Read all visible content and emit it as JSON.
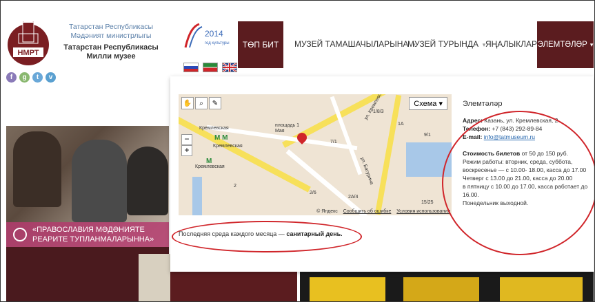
{
  "header": {
    "org_line1": "Татарстан Республикасы",
    "org_line2": "Мәдәният министрлыгы",
    "org_line3": "Татарстан Республикасы",
    "org_line4": "Милли музее",
    "logo_text": "НМРТ",
    "year_logo": "2014",
    "year_sub": "год культуры",
    "social": [
      "f",
      "g",
      "t",
      "v"
    ]
  },
  "nav": {
    "items": [
      "ТӨП БИТ",
      "МУЗЕЙ ТАМАШАЧЫЛАРЫНА",
      "МУЗЕЙ ТУРЫНДА",
      "ЯҢАЛЫКЛАР",
      "ЭЛЕМТӘЛӘР"
    ],
    "active_index": 0
  },
  "banner": {
    "text": "«ПРАВОСЛАВИЯ МӘДӘНИЯТЕ РЕАРИТЕ ТУПЛАНМАЛАРЫННА»"
  },
  "map": {
    "schema_label": "Схема",
    "labels": [
      "Кремлевская",
      "Кремлевская",
      "Кремлевская",
      "площадь 1 Мая",
      "ул. Батурина",
      "ул. Кремлевская",
      "1/8/3",
      "7/1",
      "2/6",
      "2A/4",
      "15/25",
      "1A",
      "9/1",
      "2"
    ],
    "footer": [
      "© Яндекс",
      "Сообщить об ошибке",
      "Условия использования"
    ]
  },
  "panel": {
    "title": "Элемтәләр",
    "address_label": "Адрес:",
    "address": "Казань, ул. Кремлевская, 2",
    "phone_label": "Телефон:",
    "phone": "+7 (843) 292-89-84",
    "email_label": "E-mail:",
    "email": "info@tatmuseum.ru",
    "price_label": "Стоимость билетов",
    "price": "от 50 до 150 руб.",
    "hours1": "Режим работы: вторник, среда, суббота, воскресенье — с 10.00- 18.00, касса до 17.00",
    "hours2": "Четверг с 13.00 до 21.00, касса до 20.00",
    "hours3": "в пятницу с 10.00 до 17.00, касса работает до 16.00.",
    "hours4": "Понедельник выходной.",
    "sanitary_prefix": "Последняя среда каждого месяца —",
    "sanitary_bold": "санитарный день."
  },
  "colors": {
    "maroon": "#5b1c1f",
    "accent_red": "#d0252a",
    "banner": "#b43c6e"
  }
}
